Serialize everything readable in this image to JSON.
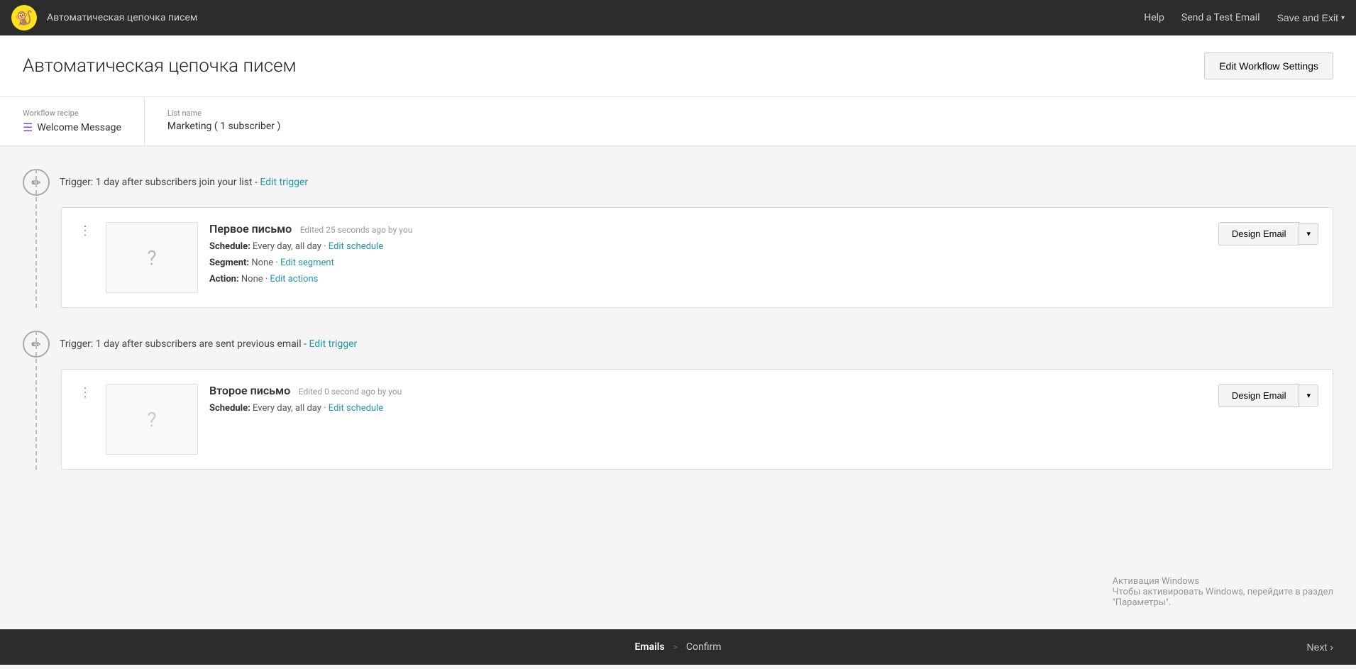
{
  "navbar": {
    "logo": "🐒",
    "title": "Автоматическая цепочка писем",
    "help_label": "Help",
    "send_test_label": "Send a Test Email",
    "save_exit_label": "Save and Exit"
  },
  "page_header": {
    "title": "Автоматическая цепочка писем",
    "edit_workflow_label": "Edit Workflow Settings"
  },
  "info_bar": {
    "workflow_recipe_label": "Workflow recipe",
    "workflow_recipe_value": "Welcome Message",
    "list_name_label": "List name",
    "list_name_value": "Marketing ( 1 subscriber )"
  },
  "email1": {
    "trigger_text": "Trigger: 1 day after subscribers join your list -",
    "trigger_link": "Edit trigger",
    "menu_dots": "⋮",
    "thumbnail_icon": "?",
    "name": "Первое письмо",
    "edited": "Edited 25 seconds ago by you",
    "schedule_label": "Schedule:",
    "schedule_value": "Every day, all day",
    "schedule_link": "Edit schedule",
    "segment_label": "Segment:",
    "segment_value": "None",
    "segment_link": "Edit segment",
    "action_label": "Action:",
    "action_value": "None",
    "action_link": "Edit actions",
    "design_btn": "Design Email"
  },
  "email2": {
    "trigger_text": "Trigger: 1 day after subscribers are sent previous email -",
    "trigger_link": "Edit trigger",
    "menu_dots": "⋮",
    "thumbnail_icon": "?",
    "name": "Второе письмо",
    "edited": "Edited 0 second ago by you",
    "schedule_label": "Schedule:",
    "schedule_value": "Every day, all day",
    "schedule_link": "Edit schedule",
    "design_btn": "Design Email"
  },
  "windows_watermark": {
    "line1": "Активация Windows",
    "line2": "Чтобы активировать Windows, перейдите в раздел",
    "line3": "\"Параметры\"."
  },
  "bottom_bar": {
    "step1": "Emails",
    "separator": ">",
    "step2": "Confirm",
    "next_label": "Next"
  }
}
